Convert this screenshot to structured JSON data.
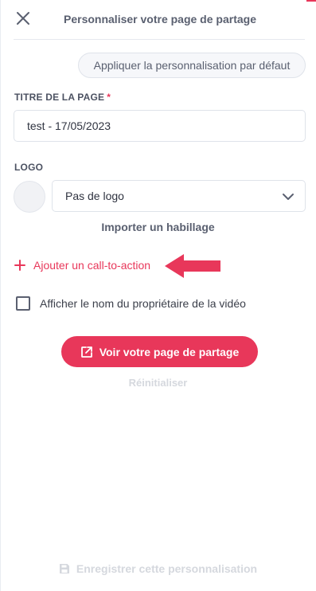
{
  "header": {
    "title": "Personnaliser votre page de partage",
    "close_icon": "close-icon"
  },
  "actions": {
    "default_button": "Appliquer la personnalisation par défaut",
    "import_link": "Importer un habillage",
    "cta_link": "Ajouter un call-to-action",
    "view_button": "Voir votre page de partage",
    "reset_link": "Réinitialiser",
    "save_button": "Enregistrer cette personnalisation"
  },
  "fields": {
    "title_label": "TITRE DE LA PAGE",
    "title_required_mark": "*",
    "title_value": "test - 17/05/2023",
    "logo_label": "LOGO",
    "logo_selected": "Pas de logo"
  },
  "options": {
    "show_owner_label": "Afficher le nom du propriétaire de la vidéo",
    "show_owner_checked": false
  },
  "colors": {
    "accent": "#e8375a",
    "text": "#3b3f4a",
    "muted": "#d5d8de",
    "border": "#dfe3ea"
  }
}
